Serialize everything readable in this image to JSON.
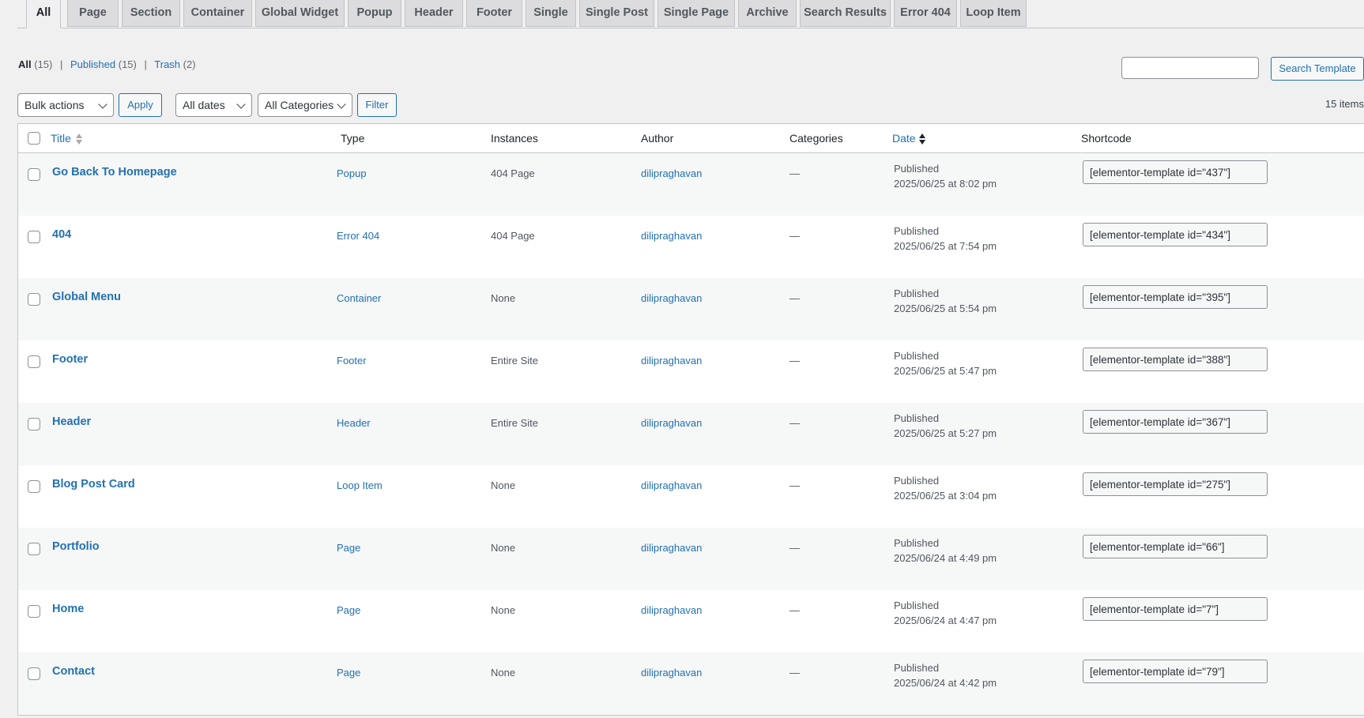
{
  "tabs": [
    {
      "label": "All",
      "active": true
    },
    {
      "label": "Page"
    },
    {
      "label": "Section"
    },
    {
      "label": "Container"
    },
    {
      "label": "Global Widget"
    },
    {
      "label": "Popup"
    },
    {
      "label": "Header"
    },
    {
      "label": "Footer"
    },
    {
      "label": "Single"
    },
    {
      "label": "Single Post"
    },
    {
      "label": "Single Page"
    },
    {
      "label": "Archive"
    },
    {
      "label": "Search Results"
    },
    {
      "label": "Error 404"
    },
    {
      "label": "Loop Item"
    }
  ],
  "status": {
    "all": "All",
    "all_count": "(15)",
    "published": "Published",
    "published_count": "(15)",
    "trash": "Trash",
    "trash_count": "(2)",
    "sep": "|"
  },
  "search": {
    "placeholder": "",
    "button": "Search Template"
  },
  "toolbar": {
    "bulk": "Bulk actions",
    "apply": "Apply",
    "dates": "All dates",
    "categories": "All Categories",
    "filter": "Filter",
    "count": "15 items"
  },
  "columns": {
    "title": "Title",
    "type": "Type",
    "instances": "Instances",
    "author": "Author",
    "categories": "Categories",
    "date": "Date",
    "shortcode": "Shortcode"
  },
  "rows": [
    {
      "title": "Go Back To Homepage",
      "type": "Popup",
      "instances": "404 Page",
      "author": "dilipraghavan",
      "categories": "—",
      "status": "Published",
      "date": "2025/06/25 at 8:02 pm",
      "shortcode": "[elementor-template id=\"437\"]"
    },
    {
      "title": "404",
      "type": "Error 404",
      "instances": "404 Page",
      "author": "dilipraghavan",
      "categories": "—",
      "status": "Published",
      "date": "2025/06/25 at 7:54 pm",
      "shortcode": "[elementor-template id=\"434\"]"
    },
    {
      "title": "Global Menu",
      "type": "Container",
      "instances": "None",
      "author": "dilipraghavan",
      "categories": "—",
      "status": "Published",
      "date": "2025/06/25 at 5:54 pm",
      "shortcode": "[elementor-template id=\"395\"]"
    },
    {
      "title": "Footer",
      "type": "Footer",
      "instances": "Entire Site",
      "author": "dilipraghavan",
      "categories": "—",
      "status": "Published",
      "date": "2025/06/25 at 5:47 pm",
      "shortcode": "[elementor-template id=\"388\"]"
    },
    {
      "title": "Header",
      "type": "Header",
      "instances": "Entire Site",
      "author": "dilipraghavan",
      "categories": "—",
      "status": "Published",
      "date": "2025/06/25 at 5:27 pm",
      "shortcode": "[elementor-template id=\"367\"]"
    },
    {
      "title": "Blog Post Card",
      "type": "Loop Item",
      "instances": "None",
      "author": "dilipraghavan",
      "categories": "—",
      "status": "Published",
      "date": "2025/06/25 at 3:04 pm",
      "shortcode": "[elementor-template id=\"275\"]"
    },
    {
      "title": "Portfolio",
      "type": "Page",
      "instances": "None",
      "author": "dilipraghavan",
      "categories": "—",
      "status": "Published",
      "date": "2025/06/24 at 4:49 pm",
      "shortcode": "[elementor-template id=\"66\"]"
    },
    {
      "title": "Home",
      "type": "Page",
      "instances": "None",
      "author": "dilipraghavan",
      "categories": "—",
      "status": "Published",
      "date": "2025/06/24 at 4:47 pm",
      "shortcode": "[elementor-template id=\"7\"]"
    },
    {
      "title": "Contact",
      "type": "Page",
      "instances": "None",
      "author": "dilipraghavan",
      "categories": "—",
      "status": "Published",
      "date": "2025/06/24 at 4:42 pm",
      "shortcode": "[elementor-template id=\"79\"]"
    }
  ]
}
